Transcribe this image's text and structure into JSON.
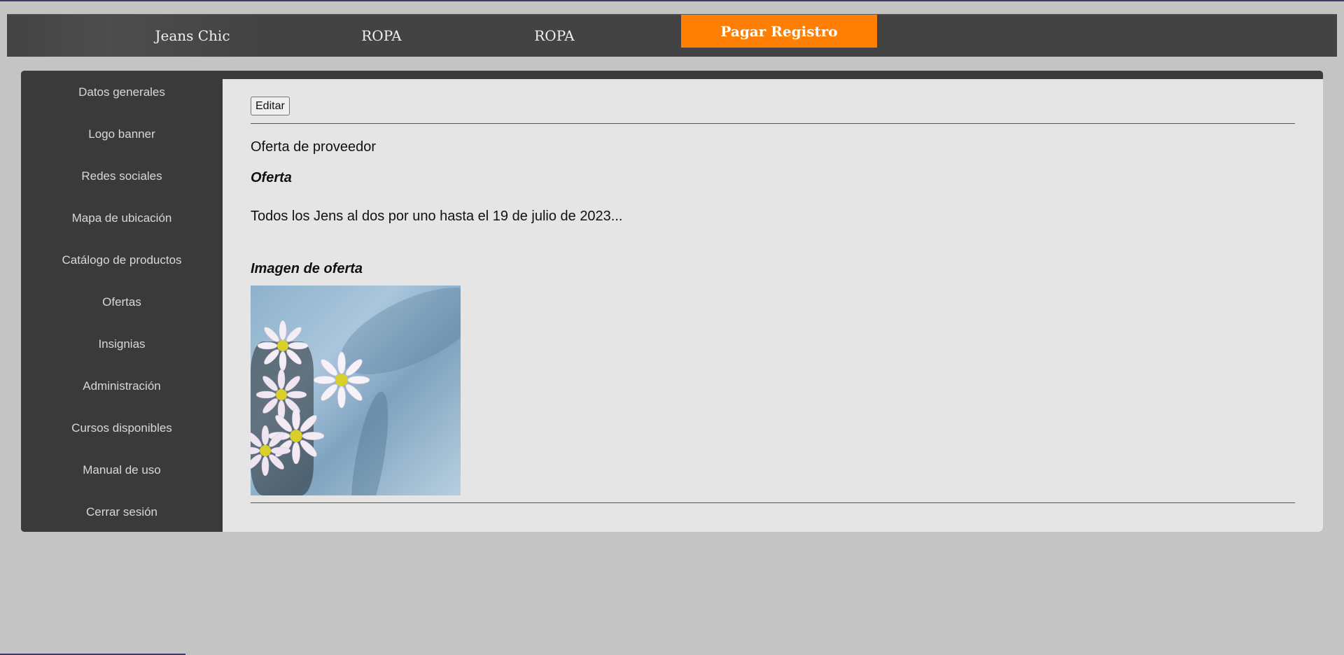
{
  "header": {
    "brand": "Jeans Chic",
    "nav": [
      "ROPA",
      "ROPA"
    ],
    "pay_label": "Pagar Registro"
  },
  "sidebar": {
    "items": [
      {
        "label": "Datos generales"
      },
      {
        "label": "Logo banner"
      },
      {
        "label": "Redes sociales"
      },
      {
        "label": "Mapa de ubicación"
      },
      {
        "label": "Catálogo de productos"
      },
      {
        "label": "Ofertas"
      },
      {
        "label": "Insignias"
      },
      {
        "label": "Administración"
      },
      {
        "label": "Cursos disponibles"
      },
      {
        "label": "Manual de uso"
      },
      {
        "label": "Cerrar sesión"
      }
    ]
  },
  "main": {
    "edit_label": "Editar",
    "provider_title": "Oferta de proveedor",
    "offer_heading": "Oferta",
    "offer_text": "Todos los Jens al dos por uno hasta el 19 de julio de 2023...",
    "image_heading": "Imagen de oferta"
  },
  "colors": {
    "accent": "#ff7f04",
    "header_bg": "#434343",
    "sidebar_bg": "#3a3a3a",
    "content_bg": "#e5e5e5"
  }
}
